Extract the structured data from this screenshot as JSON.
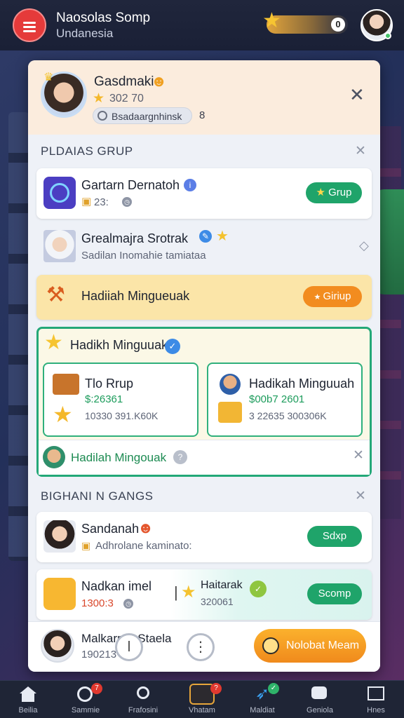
{
  "header": {
    "title": "Naosolas Somp",
    "subtitle": "Undanesia",
    "star_count": "0"
  },
  "profile": {
    "name": "Gasdmaki",
    "score": "302 70",
    "chip_text": "Bsadaargnhinsk",
    "chip_tail": "8"
  },
  "sections": {
    "group_title": "PLDAIAS GRUP",
    "second_title": "BIGHANI N GANGS"
  },
  "rows": [
    {
      "title": "Gartarn Dernatoh",
      "sub": "23:",
      "button": "Grup"
    },
    {
      "title": "Grealmajra Srotrak",
      "sub": "Sadilan Inomahie tamiataa"
    },
    {
      "title": "Hadiiah Mingueuak",
      "button": "Giriup"
    }
  ],
  "featured": {
    "title": "Hadikh Minguuak",
    "left": {
      "title": "Tlo Rrup",
      "value": "$:26361",
      "meta": "10330 391.K60K"
    },
    "right": {
      "title": "Hadikah Minguuah",
      "value": "$00b7 2601",
      "meta": "3 22635 300306K"
    },
    "footer": "Hadilah Mingouak"
  },
  "bottom_rows": [
    {
      "title": "Sandanah",
      "sub": "Adhrolane kaminato:",
      "button": "Sdxp"
    },
    {
      "title": "Nadkan imel",
      "sub": "1300:3",
      "mid_title": "Haitarak",
      "mid_sub": "320061",
      "button": "Scomp"
    }
  ],
  "action_bar": {
    "name": "Malkarr ... Staela",
    "sub": "190213",
    "cta": "Nolobat Meam"
  },
  "nav": [
    {
      "label": "Beilia",
      "icon": "home-icon"
    },
    {
      "label": "Sammie",
      "icon": "compass-icon",
      "badge": "7"
    },
    {
      "label": "Frafosini",
      "icon": "profile-icon"
    },
    {
      "label": "Vhatam",
      "icon": "game-icon",
      "badge": "?"
    },
    {
      "label": "Maldiat",
      "icon": "bird-icon"
    },
    {
      "label": "Geniola",
      "icon": "chat-icon"
    },
    {
      "label": "Hnes",
      "icon": "mail-icon"
    }
  ],
  "colors": {
    "accent_green": "#1fa46a",
    "accent_orange": "#f28c1f",
    "menu_red": "#e53a3a"
  }
}
